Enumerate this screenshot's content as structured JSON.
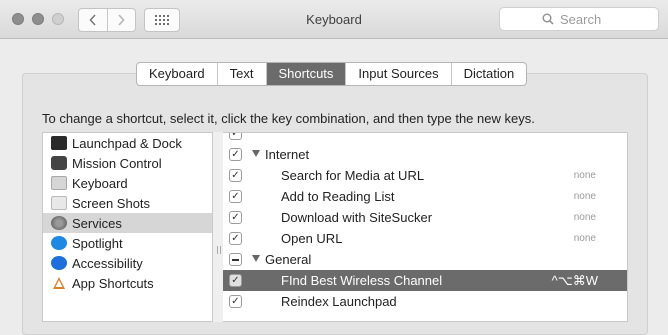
{
  "window": {
    "title": "Keyboard"
  },
  "search": {
    "placeholder": "Search"
  },
  "tabs": [
    {
      "label": "Keyboard",
      "selected": false
    },
    {
      "label": "Text",
      "selected": false
    },
    {
      "label": "Shortcuts",
      "selected": true
    },
    {
      "label": "Input Sources",
      "selected": false
    },
    {
      "label": "Dictation",
      "selected": false
    }
  ],
  "instructions": "To change a shortcut, select it, click the key combination, and then type the new keys.",
  "categories": [
    {
      "label": "Launchpad & Dock",
      "icon": "launchpad-dock-icon"
    },
    {
      "label": "Mission Control",
      "icon": "mission-control-icon"
    },
    {
      "label": "Keyboard",
      "icon": "keyboard-icon"
    },
    {
      "label": "Screen Shots",
      "icon": "screenshot-icon"
    },
    {
      "label": "Services",
      "icon": "services-gear-icon",
      "selected": true
    },
    {
      "label": "Spotlight",
      "icon": "spotlight-icon"
    },
    {
      "label": "Accessibility",
      "icon": "accessibility-icon"
    },
    {
      "label": "App Shortcuts",
      "icon": "app-shortcuts-icon"
    }
  ],
  "shortcuts": {
    "group_internet": "Internet",
    "items_internet": [
      {
        "label": "Search for Media at URL",
        "key": "none"
      },
      {
        "label": "Add to Reading List",
        "key": "none"
      },
      {
        "label": "Download with SiteSucker",
        "key": "none"
      },
      {
        "label": "Open URL",
        "key": "none"
      }
    ],
    "group_general": "General",
    "items_general": [
      {
        "label": "FInd Best Wireless Channel",
        "key": "^⌥⌘W",
        "selected": true
      },
      {
        "label": "Reindex Launchpad",
        "key": ""
      }
    ]
  },
  "colors": {
    "selection_gray": "#6b6b6b",
    "accent_blue": "#1e88e5"
  }
}
